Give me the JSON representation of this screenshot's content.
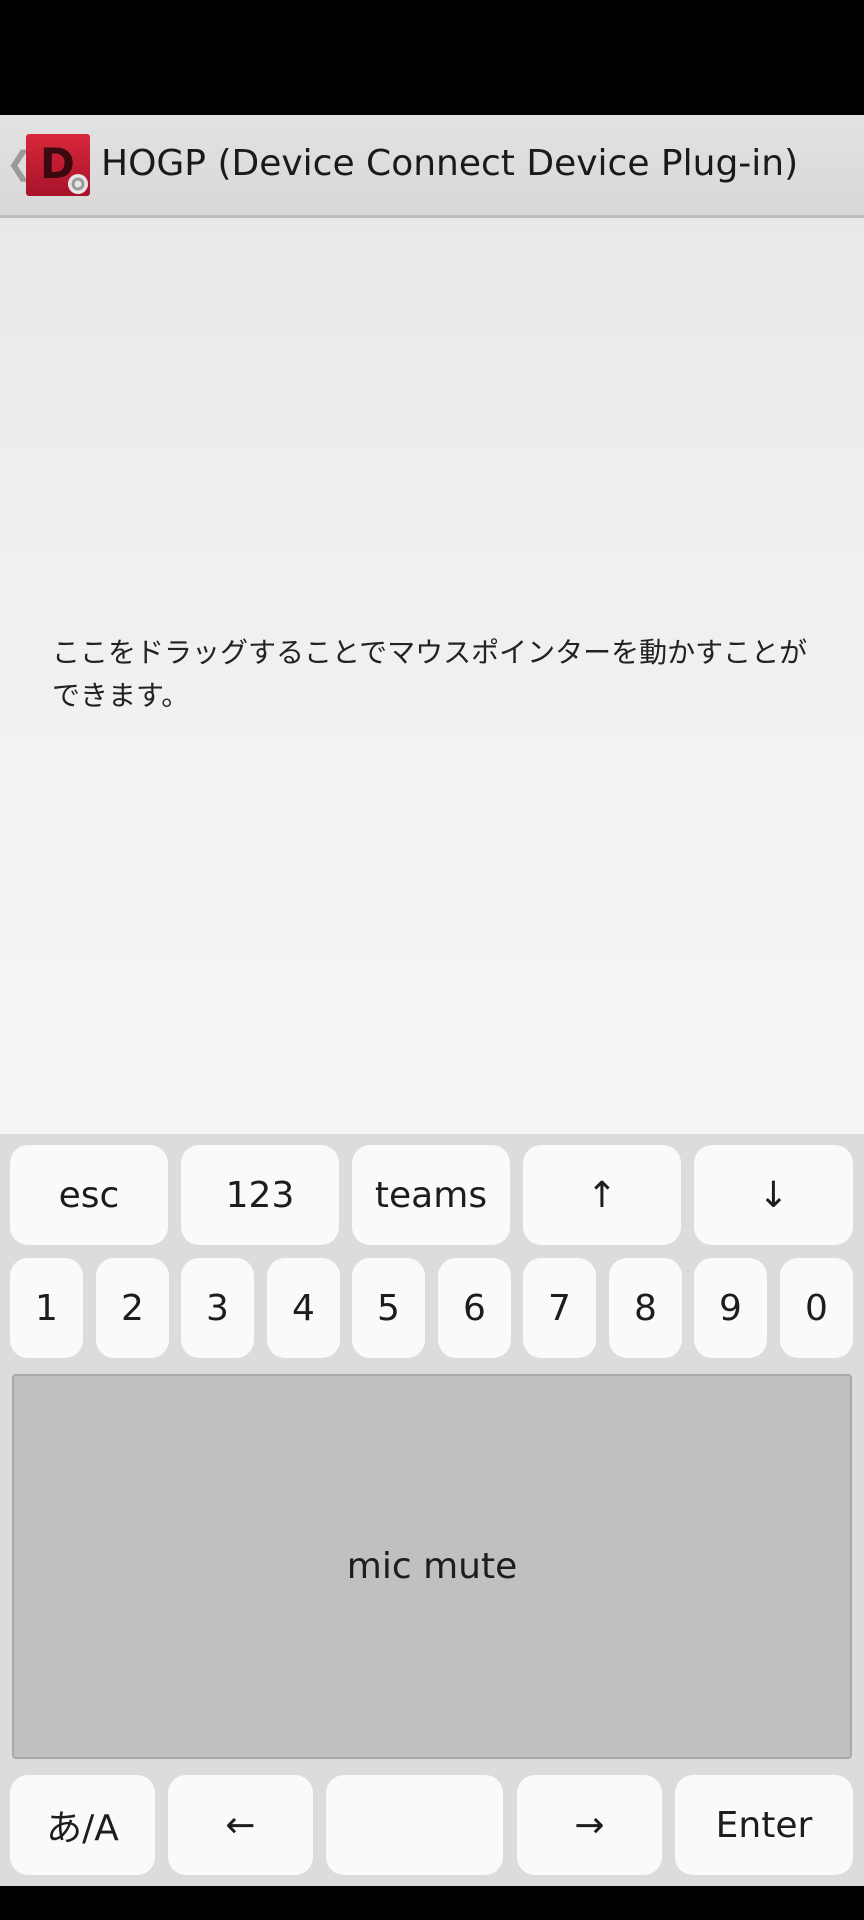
{
  "app_bar": {
    "title": "HOGP (Device Connect Device Plug-in)",
    "icon_letter": "D",
    "back_glyph": "❮"
  },
  "touch_area": {
    "hint": "ここをドラッグすることでマウスポインターを動かすことができます。"
  },
  "keyboard": {
    "row1": [
      "esc",
      "123",
      "teams",
      "↑",
      "↓"
    ],
    "digits": [
      "1",
      "2",
      "3",
      "4",
      "5",
      "6",
      "7",
      "8",
      "9",
      "0"
    ],
    "mic_mute": "mic mute",
    "bottom": {
      "ime": "あ/A",
      "left": "←",
      "space": "",
      "right": "→",
      "enter": "Enter"
    }
  },
  "colors": {
    "accent": "#c8202f",
    "key": "#fafafa",
    "mic_key": "#c0c0c0",
    "keyboard_bg": "#dcdcdc"
  }
}
